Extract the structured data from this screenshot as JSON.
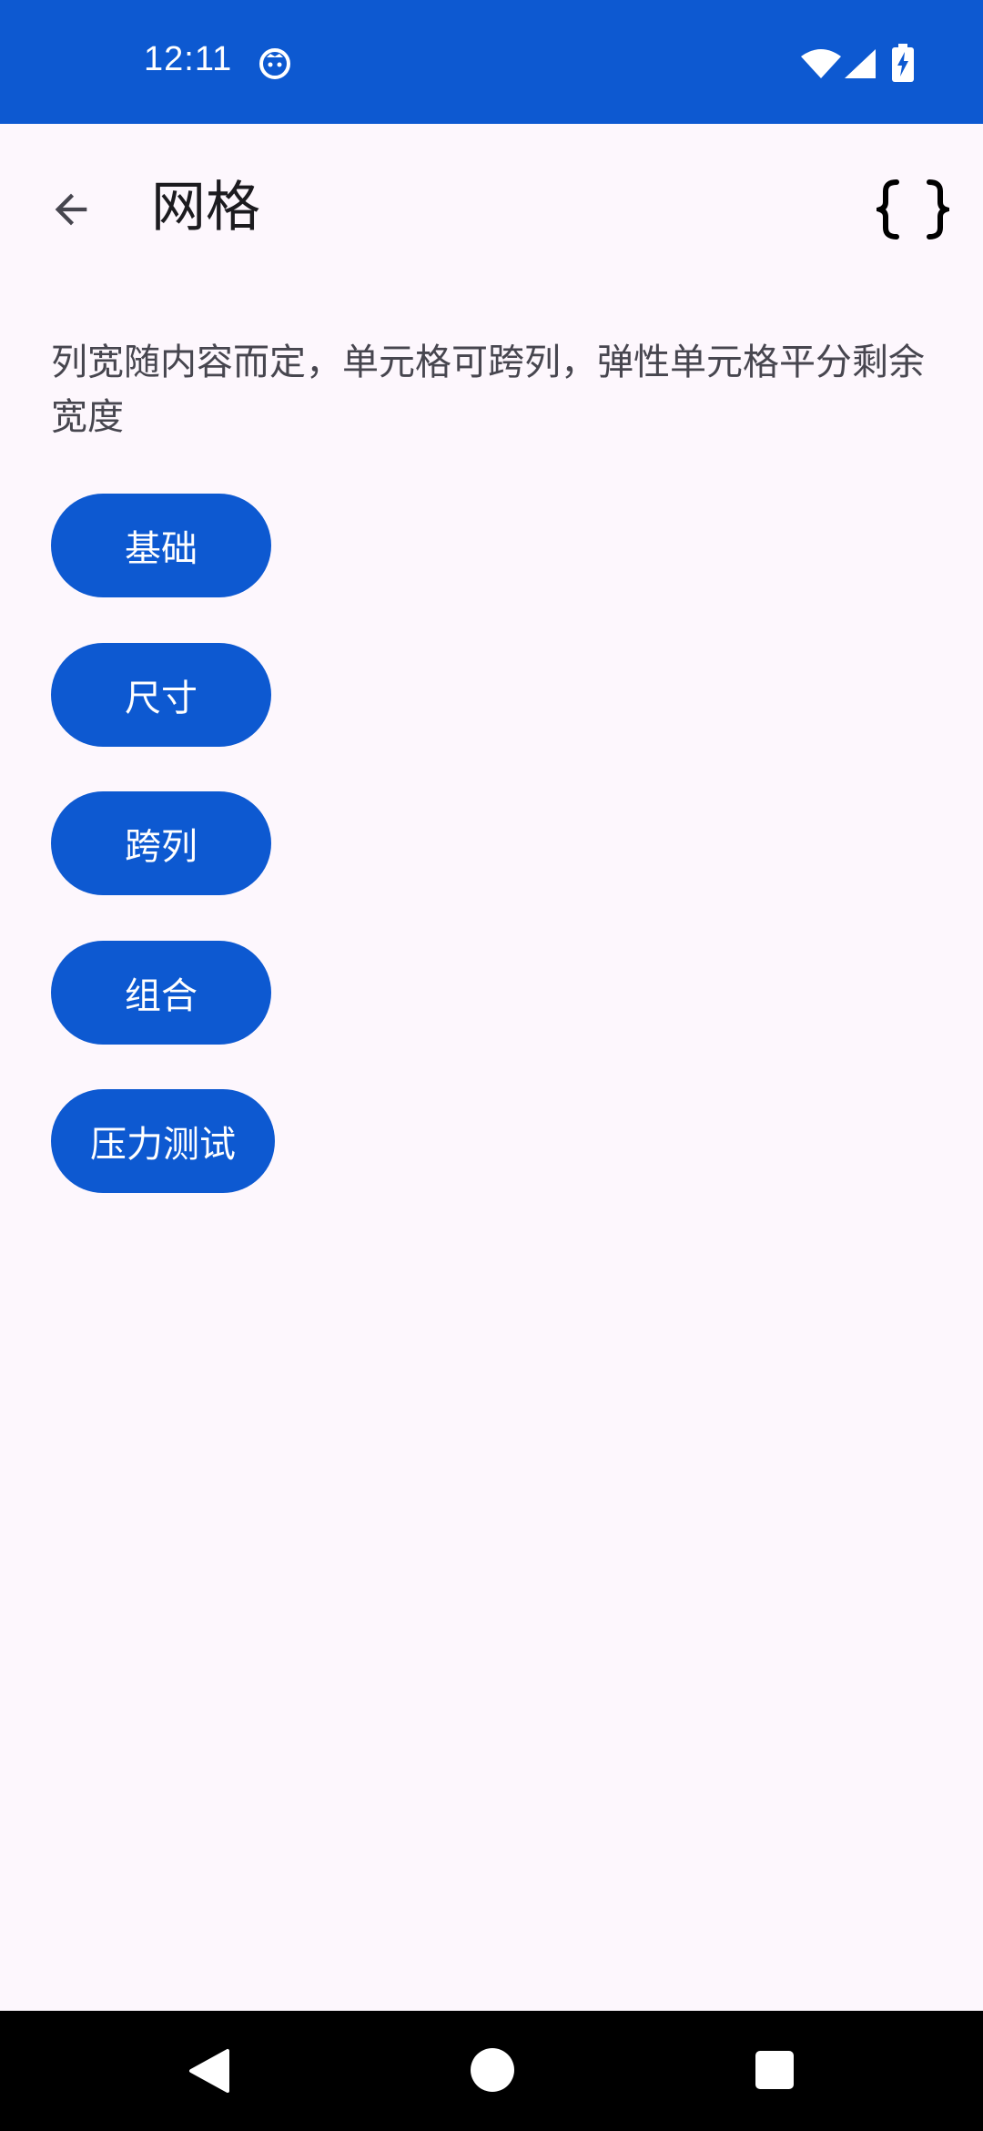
{
  "status_bar": {
    "time": "12:11",
    "background_color": "#0D59D1"
  },
  "app_bar": {
    "title": "网格",
    "back_icon": "arrow-back-icon",
    "action_icon": "code-braces-icon"
  },
  "description": "列宽随内容而定，单元格可跨列，弹性单元格平分剩余宽度",
  "buttons": [
    {
      "label": "基础"
    },
    {
      "label": "尺寸"
    },
    {
      "label": "跨列"
    },
    {
      "label": "组合"
    },
    {
      "label": "压力测试"
    }
  ],
  "nav_bar": {
    "icons": [
      "nav-back-icon",
      "nav-home-icon",
      "nav-recents-icon"
    ]
  },
  "colors": {
    "primary": "#0D59D1",
    "background": "#FDF7FD",
    "text": "#1C1B1F"
  }
}
